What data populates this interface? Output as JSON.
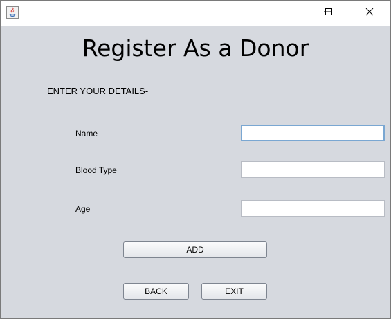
{
  "window": {
    "title": "",
    "controls": {
      "minimize_glyph": "—",
      "maximize_glyph": "☐",
      "close_glyph": "✕"
    }
  },
  "form": {
    "heading": "Register As a Donor",
    "subheading": "ENTER YOUR DETAILS-",
    "fields": [
      {
        "label": "Name",
        "value": "",
        "focused": true
      },
      {
        "label": "Blood Type",
        "value": ""
      },
      {
        "label": "Age",
        "value": ""
      }
    ]
  },
  "buttons": {
    "add": "ADD",
    "back": "BACK",
    "exit": "EXIT"
  },
  "icons": [
    "java-app-icon",
    "minimize-icon",
    "maximize-icon",
    "close-icon"
  ],
  "colors": {
    "background": "#d6d9df",
    "field_focus_border": "#7aa7d2"
  }
}
